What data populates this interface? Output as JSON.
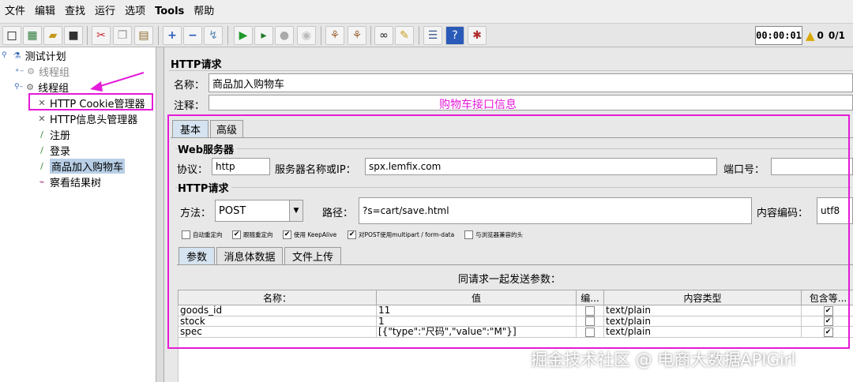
{
  "menu": [
    "文件",
    "编辑",
    "查找",
    "运行",
    "选项",
    "Tools",
    "帮助"
  ],
  "toolbar": {
    "icons": [
      "new-icon",
      "templates-icon",
      "open-icon",
      "save-icon",
      "cut-icon",
      "copy-icon",
      "paste-icon",
      "expand-icon",
      "collapse-icon",
      "toggle-icon",
      "start-icon",
      "start-no-pause-icon",
      "stop-icon",
      "shutdown-icon",
      "clear-icon",
      "clear-all-icon",
      "search-icon",
      "reset-search-icon",
      "function-helper-icon",
      "help-icon",
      "remote-icon"
    ],
    "timer": "00:00:01",
    "warnings": "0",
    "threads": "0/1"
  },
  "tree": [
    {
      "label": "测试计划",
      "icon": "test-plan-icon",
      "dim": false
    },
    {
      "label": "线程组",
      "icon": "thread-group-icon",
      "dim": true
    },
    {
      "label": "线程组",
      "icon": "thread-group-icon",
      "dim": false
    },
    {
      "label": "HTTP Cookie管理器",
      "icon": "config-element-icon",
      "dim": false
    },
    {
      "label": "HTTP信息头管理器",
      "icon": "config-element-icon",
      "dim": false
    },
    {
      "label": "注册",
      "icon": "sampler-icon",
      "dim": false
    },
    {
      "label": "登录",
      "icon": "sampler-icon",
      "dim": false
    },
    {
      "label": "商品加入购物车",
      "icon": "sampler-icon",
      "dim": false,
      "selected": true
    },
    {
      "label": "察看结果树",
      "icon": "listener-icon",
      "dim": false
    }
  ],
  "panel": {
    "title": "HTTP请求",
    "name_label": "名称：",
    "name_value": "商品加入购物车",
    "comment_label": "注释：",
    "comment_value": "",
    "tabs": [
      "基本",
      "高级"
    ],
    "web_server": {
      "title": "Web服务器",
      "protocol_label": "协议：",
      "protocol_value": "http",
      "server_label": "服务器名称或IP：",
      "server_value": "spx.lemfix.com",
      "port_label": "端口号：",
      "port_value": ""
    },
    "http_request": {
      "title": "HTTP请求",
      "method_label": "方法：",
      "method_value": "POST",
      "path_label": "路径：",
      "path_value": "?s=cart/save.html",
      "encoding_label": "内容编码：",
      "encoding_value": "utf8"
    },
    "options": [
      {
        "label": "自动重定向",
        "checked": false
      },
      {
        "label": "跟随重定向",
        "checked": true
      },
      {
        "label": "使用 KeepAlive",
        "checked": true
      },
      {
        "label": "对POST使用multipart / form-data",
        "checked": true
      },
      {
        "label": "与浏览器兼容的头",
        "checked": false
      }
    ],
    "subtabs": [
      "参数",
      "消息体数据",
      "文件上传"
    ],
    "params_caption": "同请求一起发送参数：",
    "columns": [
      "名称：",
      "值",
      "编...",
      "内容类型",
      "包含等..."
    ],
    "rows": [
      {
        "name": "goods_id",
        "value": "11",
        "encode": false,
        "content_type": "text/plain",
        "include_equals": true
      },
      {
        "name": "stock",
        "value": "1",
        "encode": false,
        "content_type": "text/plain",
        "include_equals": true
      },
      {
        "name": "spec",
        "value": "[{\"type\":\"尺码\",\"value\":\"M\"}]",
        "encode": false,
        "content_type": "text/plain",
        "include_equals": true
      }
    ]
  },
  "annotation": {
    "text": "购物车接口信息",
    "color": "#e41bd8"
  },
  "watermark": "掘金技术社区 @ 电商大数据APIGirl"
}
